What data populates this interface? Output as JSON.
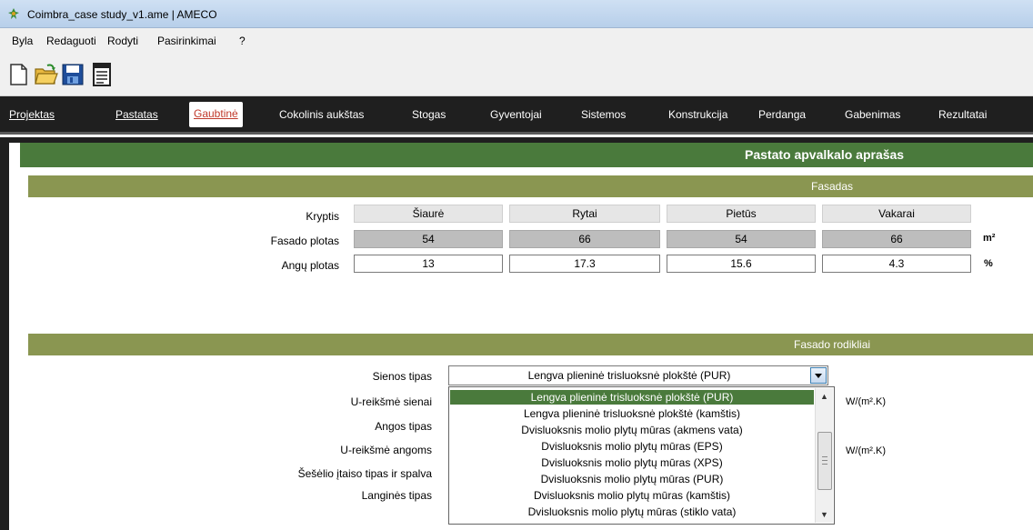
{
  "window": {
    "title": "Coimbra_case study_v1.ame | AMECO"
  },
  "menu": [
    "Byla",
    "Redaguoti",
    "Rodyti",
    "Pasirinkimai",
    "?"
  ],
  "toolbar": {
    "icons": [
      "new-file-icon",
      "open-folder-icon",
      "save-icon",
      "notes-icon"
    ]
  },
  "tabs": [
    "Projektas",
    "Pastatas",
    "Gaubtinė",
    "Cokolinis aukštas",
    "Stogas",
    "Gyventojai",
    "Sistemos",
    "Konstrukcija",
    "Perdanga",
    "Gabenimas",
    "Rezultatai"
  ],
  "active_tab": "Gaubtinė",
  "section_title": "Pastato apvalkalo aprašas",
  "facade": {
    "header": "Fasadas",
    "direction_label": "Kryptis",
    "area_label": "Fasado plotas",
    "window_area_label": "Angų plotas",
    "directions": [
      "Šiaurė",
      "Rytai",
      "Pietūs",
      "Vakarai"
    ],
    "areas": [
      "54",
      "66",
      "54",
      "66"
    ],
    "window_areas": [
      "13",
      "17.3",
      "15.6",
      "4.3"
    ],
    "area_unit": "m²",
    "window_unit": "%"
  },
  "indicators": {
    "header": "Fasado rodikliai",
    "labels": [
      "Sienos tipas",
      "U-reikšmė sienai",
      "Angos tipas",
      "U-reikšmė angoms",
      "Šešėlio įtaiso tipas ir spalva",
      "Langinės tipas"
    ],
    "wall_type_value": "Lengva plieninė trisluoksnė plokštė (PUR)",
    "u_wall_unit": "W/(m².K)",
    "u_window_unit": "W/(m².K)"
  },
  "dropdown_options": [
    "Lengva plieninė trisluoksnė plokštė (PUR)",
    "Lengva plieninė trisluoksnė plokštė (kamštis)",
    "Dvisluoksnis molio plytų mūras (akmens vata)",
    "Dvisluoksnis molio plytų mūras (EPS)",
    "Dvisluoksnis molio plytų mūras (XPS)",
    "Dvisluoksnis molio plytų mūras (PUR)",
    "Dvisluoksnis molio plytų mūras (kamštis)",
    "Dvisluoksnis molio plytų mūras (stiklo vata)"
  ],
  "colors": {
    "section_green": "#4a7a3c",
    "subheader_olive": "#8a9651",
    "tab_active_text": "#c0392b",
    "tabbar_bg": "#1f1f1f"
  }
}
